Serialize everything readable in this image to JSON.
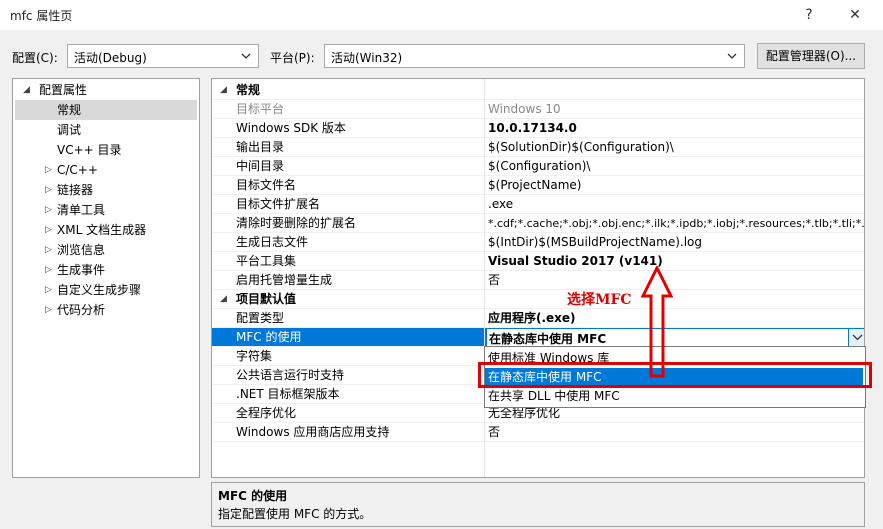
{
  "window": {
    "title": "mfc 属性页",
    "help_glyph": "?",
    "close_glyph": "✕"
  },
  "toolbar": {
    "config_label": "配置(C):",
    "config_value": "活动(Debug)",
    "platform_label": "平台(P):",
    "platform_value": "活动(Win32)",
    "config_manager_label": "配置管理器(O)..."
  },
  "tree": {
    "root": "配置属性",
    "items": [
      "常规",
      "调试",
      "VC++ 目录",
      "C/C++",
      "链接器",
      "清单工具",
      "XML 文档生成器",
      "浏览信息",
      "生成事件",
      "自定义生成步骤",
      "代码分析"
    ]
  },
  "grid": {
    "section_general": "常规",
    "general_rows": [
      {
        "name": "目标平台",
        "value": "Windows 10"
      },
      {
        "name": "Windows SDK 版本",
        "value": "10.0.17134.0"
      },
      {
        "name": "输出目录",
        "value": "$(SolutionDir)$(Configuration)\\"
      },
      {
        "name": "中间目录",
        "value": "$(Configuration)\\"
      },
      {
        "name": "目标文件名",
        "value": "$(ProjectName)"
      },
      {
        "name": "目标文件扩展名",
        "value": ".exe"
      },
      {
        "name": "清除时要删除的扩展名",
        "value": "*.cdf;*.cache;*.obj;*.obj.enc;*.ilk;*.ipdb;*.iobj;*.resources;*.tlb;*.tli;*.t"
      },
      {
        "name": "生成日志文件",
        "value": "$(IntDir)$(MSBuildProjectName).log"
      },
      {
        "name": "平台工具集",
        "value": "Visual Studio 2017 (v141)"
      },
      {
        "name": "启用托管增量生成",
        "value": "否"
      }
    ],
    "section_defaults": "项目默认值",
    "default_rows": [
      {
        "name": "配置类型",
        "value": "应用程序(.exe)"
      },
      {
        "name": "MFC 的使用",
        "value": "在静态库中使用 MFC"
      },
      {
        "name": "字符集",
        "value": ""
      },
      {
        "name": "公共语言运行时支持",
        "value": ""
      },
      {
        "name": ".NET 目标框架版本",
        "value": ""
      },
      {
        "name": "全程序优化",
        "value": "无全程序优化"
      },
      {
        "name": "Windows 应用商店应用支持",
        "value": "否"
      }
    ]
  },
  "dropdown": {
    "options": [
      "使用标准 Windows 库",
      "在静态库中使用 MFC",
      "在共享 DLL 中使用 MFC"
    ]
  },
  "annotation": {
    "text": "选择MFC",
    "color": "#e00000"
  },
  "description": {
    "title": "MFC 的使用",
    "text": "指定配置使用 MFC 的方式。"
  },
  "colors": {
    "selection": "#0078d7",
    "accent_red": "#e00000"
  }
}
